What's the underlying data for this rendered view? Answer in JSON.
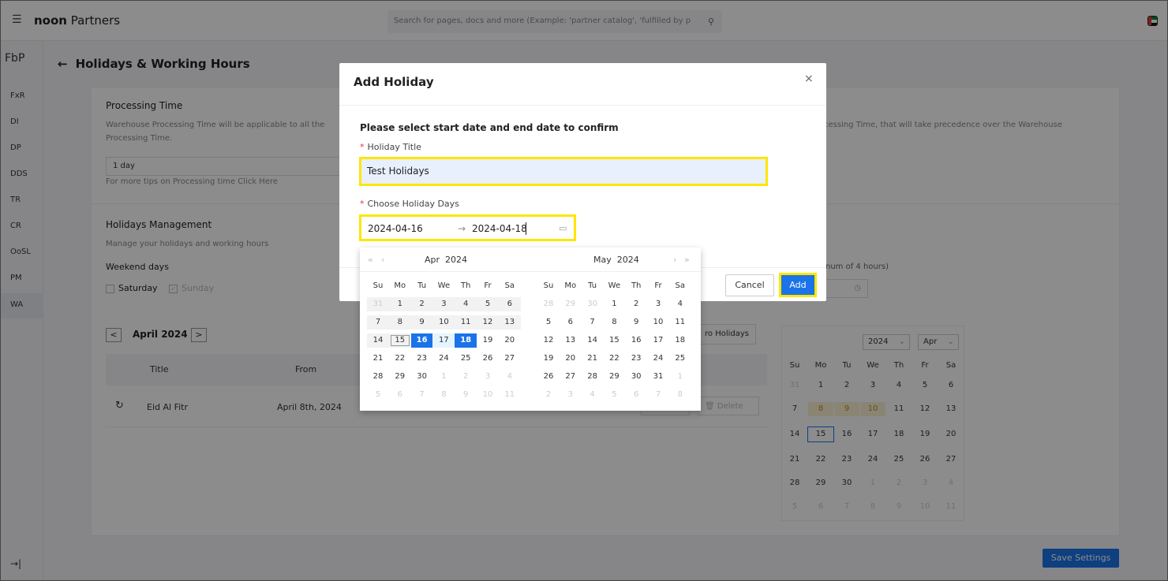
{
  "topbar": {
    "brand_bold": "noon",
    "brand_rest": " Partners",
    "search_placeholder": "Search for pages, docs and more (Example: 'partner catalog', 'fulfilled by p"
  },
  "sidebar": {
    "brand": "FbP",
    "items": [
      "FxR",
      "DI",
      "DP",
      "DDS",
      "TR",
      "CR",
      "OoSL",
      "PM",
      "WA"
    ],
    "collapse": "→|"
  },
  "page": {
    "title": "Holidays & Working Hours",
    "processing": {
      "heading": "Processing Time",
      "desc1": "Warehouse Processing Time will be applicable to all the",
      "desc2": "Processing Time.",
      "desc_right": "cessing Time, that will take precedence over the Warehouse",
      "select_value": "1 day",
      "tips": "For more tips on Processing time Click Here"
    },
    "holidays": {
      "heading": "Holidays Management",
      "desc": "Manage your holidays and working hours",
      "weekend_label": "Weekend days",
      "saturday": "Saturday",
      "sunday": "Sunday",
      "max_hint": "num of 4 hours)",
      "month_label": "April 2024",
      "prev": "<",
      "next": ">",
      "col_title": "Title",
      "col_from": "From",
      "row_title": "Eid Al Fitr",
      "row_from": "April 8th, 2024",
      "import_btn": "ro Holidays",
      "delete_btn": "Delete"
    },
    "mini_cal": {
      "year": "2024",
      "month": "Apr",
      "weekdays": [
        "Su",
        "Mo",
        "Tu",
        "We",
        "Th",
        "Fr",
        "Sa"
      ],
      "weeks": [
        [
          "31",
          "1",
          "2",
          "3",
          "4",
          "5",
          "6"
        ],
        [
          "7",
          "8",
          "9",
          "10",
          "11",
          "12",
          "13"
        ],
        [
          "14",
          "15",
          "16",
          "17",
          "18",
          "19",
          "20"
        ],
        [
          "21",
          "22",
          "23",
          "24",
          "25",
          "26",
          "27"
        ],
        [
          "28",
          "29",
          "30",
          "1",
          "2",
          "3",
          "4"
        ],
        [
          "5",
          "6",
          "7",
          "8",
          "9",
          "10",
          "11"
        ]
      ]
    },
    "save": "Save Settings"
  },
  "modal": {
    "title": "Add Holiday",
    "close": "×",
    "instruction": "Please select start date and end date to confirm",
    "title_label": "Holiday Title",
    "title_value": "Test Holidays",
    "days_label": "Choose Holiday Days",
    "start": "2024-04-16",
    "arrow": "→",
    "end": "2024-04-18",
    "cancel": "Cancel",
    "add": "Add"
  },
  "picker": {
    "left_month": "Apr",
    "left_year": "2024",
    "right_month": "May",
    "right_year": "2024",
    "weekdays": [
      "Su",
      "Mo",
      "Tu",
      "We",
      "Th",
      "Fr",
      "Sa"
    ],
    "april": [
      [
        "31",
        "1",
        "2",
        "3",
        "4",
        "5",
        "6"
      ],
      [
        "7",
        "8",
        "9",
        "10",
        "11",
        "12",
        "13"
      ],
      [
        "14",
        "15",
        "16",
        "17",
        "18",
        "19",
        "20"
      ],
      [
        "21",
        "22",
        "23",
        "24",
        "25",
        "26",
        "27"
      ],
      [
        "28",
        "29",
        "30",
        "1",
        "2",
        "3",
        "4"
      ],
      [
        "5",
        "6",
        "7",
        "8",
        "9",
        "10",
        "11"
      ]
    ],
    "may": [
      [
        "28",
        "29",
        "30",
        "1",
        "2",
        "3",
        "4"
      ],
      [
        "5",
        "6",
        "7",
        "8",
        "9",
        "10",
        "11"
      ],
      [
        "12",
        "13",
        "14",
        "15",
        "16",
        "17",
        "18"
      ],
      [
        "19",
        "20",
        "21",
        "22",
        "23",
        "24",
        "25"
      ],
      [
        "26",
        "27",
        "28",
        "29",
        "30",
        "31",
        "1"
      ],
      [
        "2",
        "3",
        "4",
        "5",
        "6",
        "7",
        "8"
      ]
    ],
    "range_start": "16",
    "range_end": "18",
    "today": "15"
  },
  "colors": {
    "accent": "#1a73e8",
    "highlight": "#ffe600",
    "holiday_bg": "#fcf0d4"
  }
}
